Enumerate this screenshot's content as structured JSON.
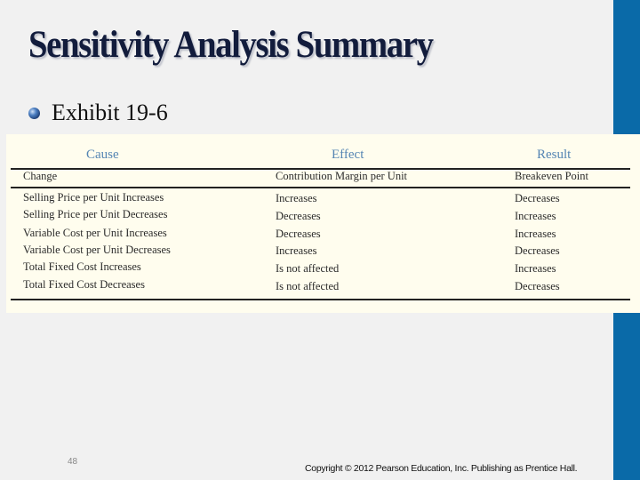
{
  "slide": {
    "title": "Sensitivity Analysis Summary",
    "bullet": "Exhibit 19-6",
    "page_number": "48",
    "copyright": "Copyright © 2012 Pearson Education, Inc. Publishing as Prentice Hall.",
    "accent_color": "#0a6aa8"
  },
  "table": {
    "group_headers": [
      "Cause",
      "Effect",
      "Result"
    ],
    "column_headers": [
      "Change",
      "Contribution Margin per Unit",
      "Breakeven Point"
    ],
    "rows": [
      [
        "Selling Price per Unit Increases",
        "Increases",
        "Decreases"
      ],
      [
        "Selling Price per Unit Decreases",
        "Decreases",
        "Increases"
      ],
      [
        "Variable Cost per Unit Increases",
        "Decreases",
        "Increases"
      ],
      [
        "Variable Cost per Unit Decreases",
        "Increases",
        "Decreases"
      ],
      [
        "Total Fixed Cost Increases",
        "Is not affected",
        "Increases"
      ],
      [
        "Total Fixed Cost Decreases",
        "Is not affected",
        "Decreases"
      ]
    ]
  }
}
